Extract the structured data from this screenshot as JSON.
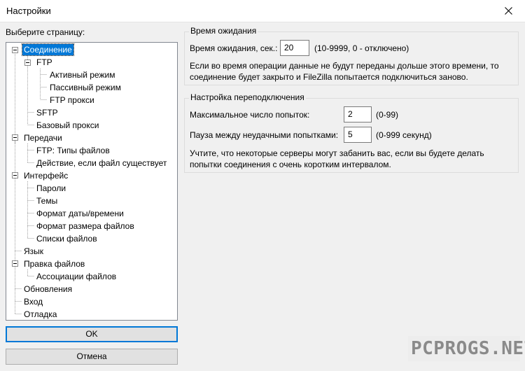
{
  "window": {
    "title": "Настройки",
    "close_icon": "close-icon"
  },
  "left": {
    "label": "Выберите страницу:"
  },
  "tree": {
    "nodes": [
      "Соединение",
      "FTP",
      "Активный режим",
      "Пассивный режим",
      "FTP прокси",
      "SFTP",
      "Базовый прокси",
      "Передачи",
      "FTP: Типы файлов",
      "Действие, если файл существует",
      "Интерфейс",
      "Пароли",
      "Темы",
      "Формат даты/времени",
      "Формат размера файлов",
      "Списки файлов",
      "Язык",
      "Правка файлов",
      "Ассоциации файлов",
      "Обновления",
      "Вход",
      "Отладка"
    ],
    "selected": "Соединение"
  },
  "buttons": {
    "ok": "OK",
    "cancel": "Отмена"
  },
  "timeout": {
    "title": "Время ожидания",
    "label": "Время ожидания, сек.:",
    "value": "20",
    "range": "(10-9999, 0 - отключено)",
    "note_line1": "Если во время операции данные не будут переданы дольше этого времени, то",
    "note_line2": "соединение будет закрыто и FileZilla попытается подключиться заново."
  },
  "reconnect": {
    "title": "Настройка переподключения",
    "attempts_label": "Максимальное число попыток:",
    "attempts_value": "2",
    "attempts_range": "(0-99)",
    "pause_label": "Пауза между неудачными попытками:",
    "pause_value": "5",
    "pause_range": "(0-999 секунд)",
    "note_line1": "Учтите, что некоторые серверы могут забанить вас, если вы будете делать",
    "note_line2": "попытки соединения с очень коротким интервалом."
  },
  "watermark": "PCPROGS.NET"
}
